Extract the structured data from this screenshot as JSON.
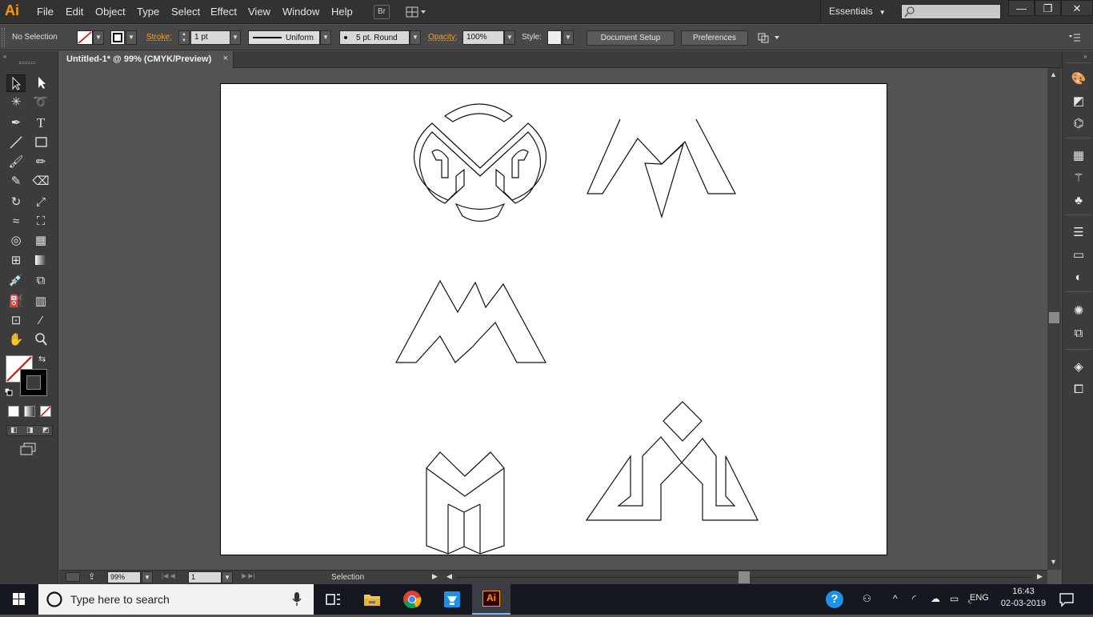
{
  "app": {
    "logo": "Ai",
    "menus": [
      "File",
      "Edit",
      "Object",
      "Type",
      "Select",
      "Effect",
      "View",
      "Window",
      "Help"
    ],
    "bridge_label": "Br",
    "workspace": "Essentials",
    "window_controls": [
      "—",
      "❐",
      "✕"
    ]
  },
  "control_bar": {
    "selection_status": "No Selection",
    "stroke_label": "Stroke:",
    "stroke_weight": "1 pt",
    "profile": "Uniform",
    "brush": "5 pt. Round",
    "opacity_label": "Opacity:",
    "opacity_value": "100%",
    "style_label": "Style:",
    "document_setup": "Document Setup",
    "preferences": "Preferences"
  },
  "document": {
    "tab_title": "Untitled-1* @ 99% (CMYK/Preview)",
    "tab_close": "×"
  },
  "status_bar": {
    "zoom": "99%",
    "artboard_number": "1",
    "current_tool": "Selection"
  },
  "taskbar": {
    "search_placeholder": "Type here to search",
    "language": "ENG",
    "time": "16:43",
    "date": "02-03-2019",
    "active_app_label": "Ai"
  },
  "colors": {
    "accent_orange": "#ff9a00",
    "stroke_orange": "#f0a030",
    "chrome_dark": "#323232",
    "canvas_bg": "#535353"
  }
}
